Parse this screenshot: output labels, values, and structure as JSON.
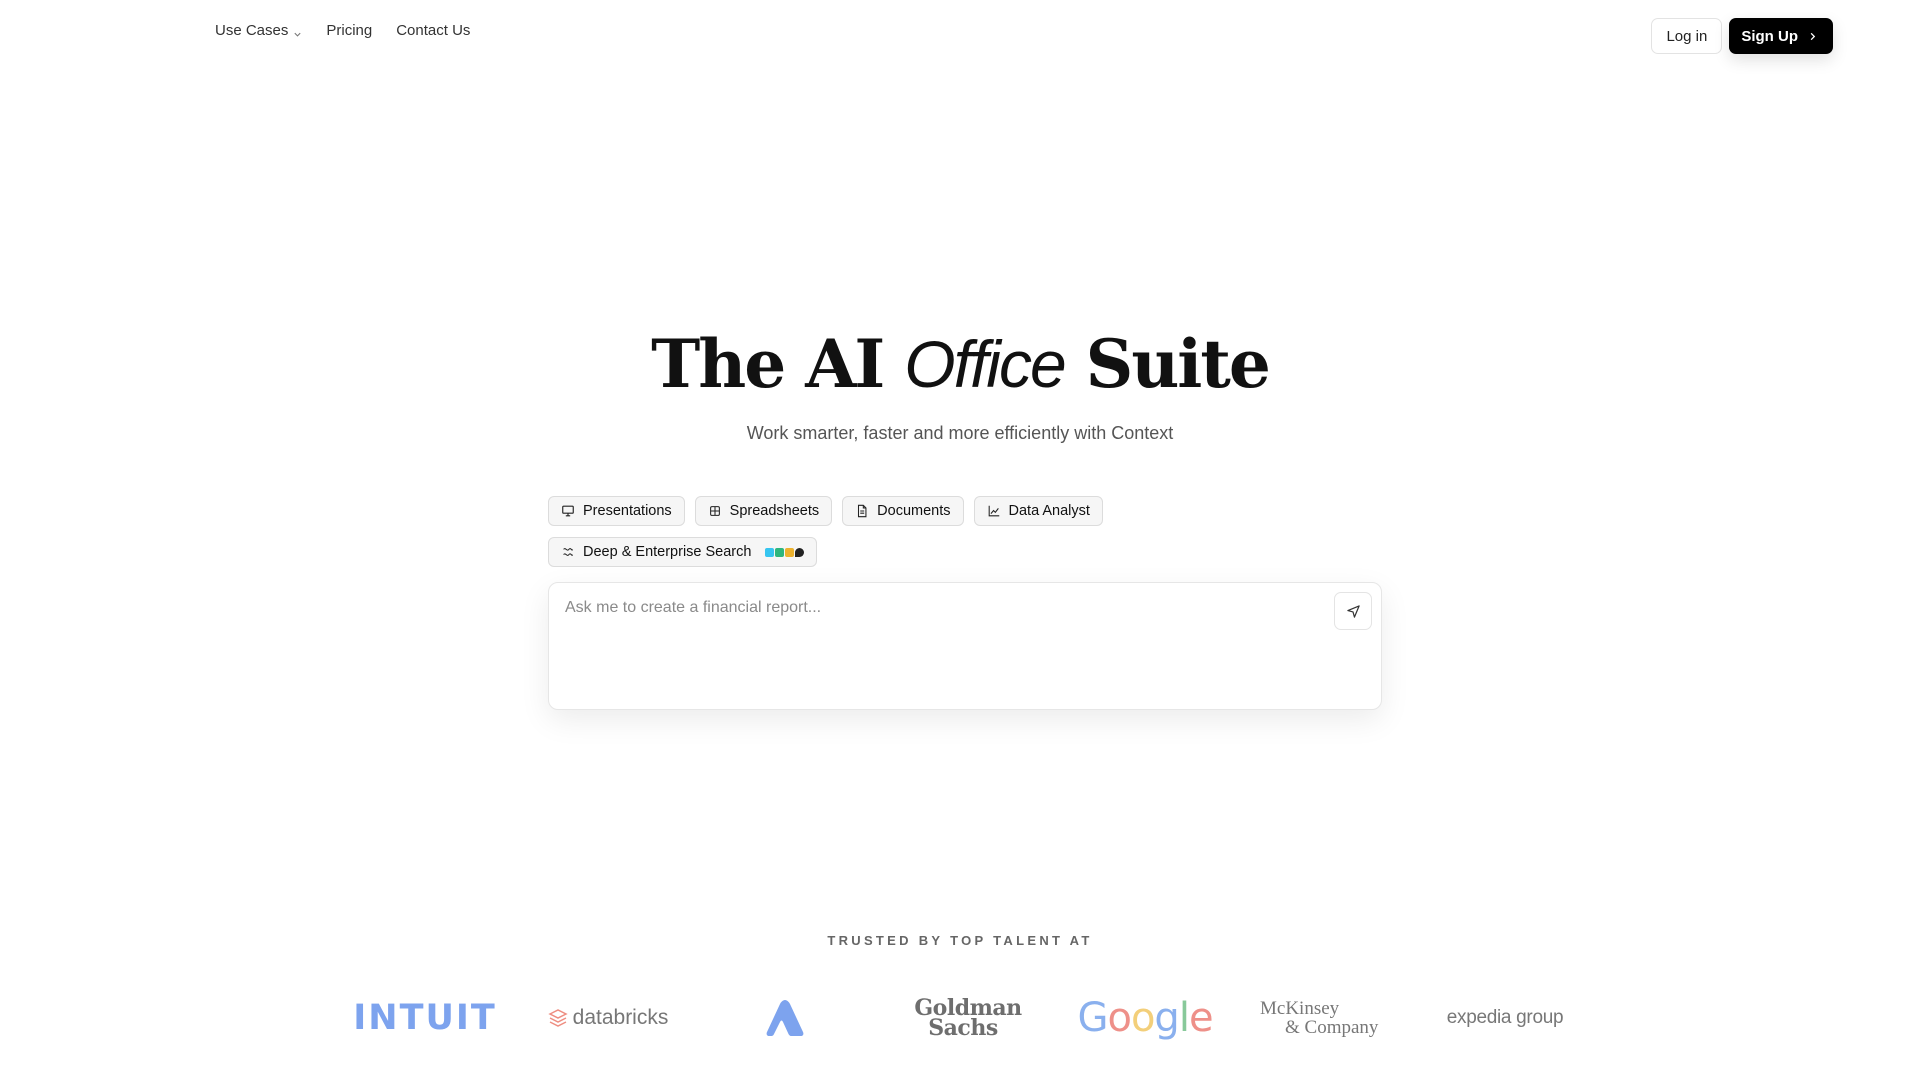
{
  "header": {
    "nav": [
      {
        "label": "Use Cases",
        "has_dropdown": true
      },
      {
        "label": "Pricing"
      },
      {
        "label": "Contact Us"
      }
    ],
    "login_label": "Log in",
    "signup_label": "Sign Up"
  },
  "hero": {
    "title_prefix": "The AI",
    "title_italic": "Office",
    "title_suffix": "Suite",
    "subtitle": "Work smarter, faster and more efficiently with Context"
  },
  "tools": [
    {
      "label": "Presentations",
      "icon": "presentation-icon"
    },
    {
      "label": "Spreadsheets",
      "icon": "spreadsheet-icon"
    },
    {
      "label": "Documents",
      "icon": "document-icon"
    },
    {
      "label": "Data Analyst",
      "icon": "chart-icon"
    },
    {
      "label": "Deep & Enterprise Search",
      "icon": "search-sources-icon"
    }
  ],
  "prompt": {
    "placeholder": "Ask me to create a financial report...",
    "value": ""
  },
  "trusted": {
    "label": "TRUSTED BY TOP TALENT AT",
    "logos": {
      "intuit": "INTUIT",
      "databricks": "databricks",
      "atlassian": "Atlassian",
      "goldman_l1": "Goldman",
      "goldman_l2": "Sachs",
      "google_g1": "G",
      "google_o1": "o",
      "google_o2": "o",
      "google_g2": "g",
      "google_l": "l",
      "google_e": "e",
      "mckinsey_l1": "McKinsey",
      "mckinsey_l2": "& Company",
      "expedia": "expedia group"
    }
  },
  "colors": {
    "signup_bg": "#000000",
    "chip_bg": "#f6f6f6",
    "intuit": "#7da3ee",
    "atlassian": "#7da3ee"
  }
}
